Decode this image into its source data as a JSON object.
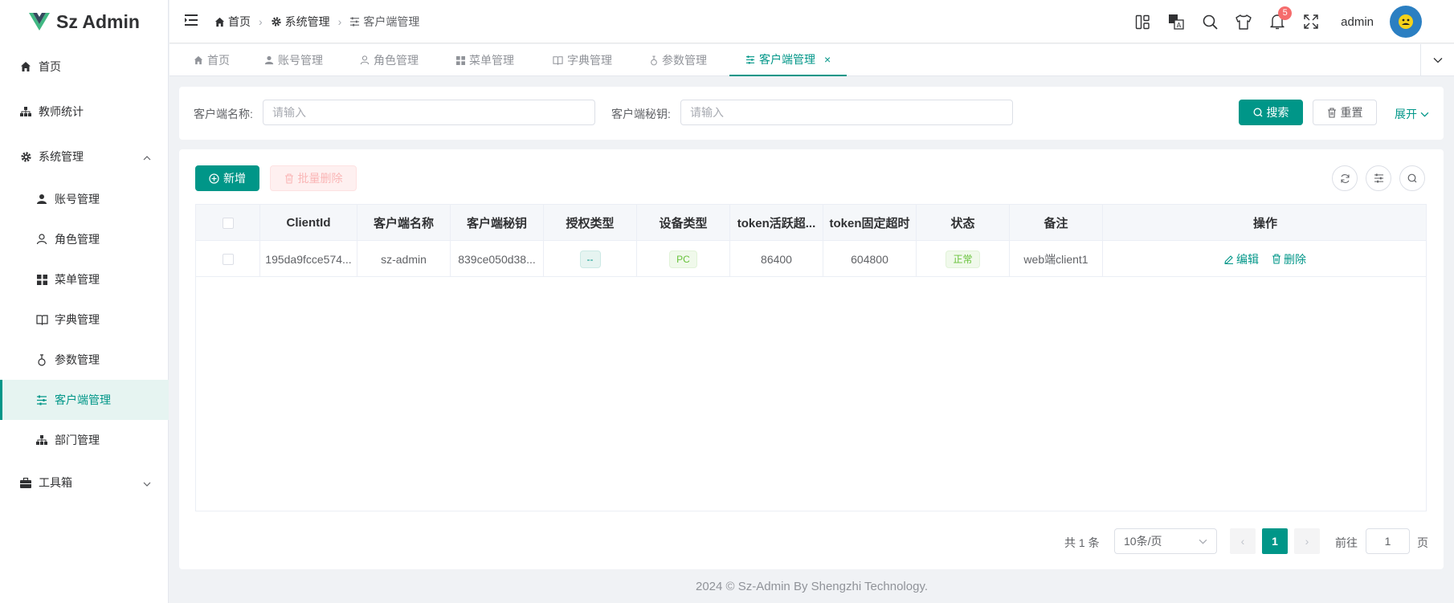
{
  "app": {
    "title": "Sz Admin"
  },
  "sidebar": {
    "items": [
      {
        "label": "首页",
        "icon": "home-icon"
      },
      {
        "label": "教师统计",
        "icon": "org-icon"
      },
      {
        "label": "系统管理",
        "icon": "gear-icon"
      },
      {
        "label": "账号管理",
        "icon": "user-icon"
      },
      {
        "label": "角色管理",
        "icon": "user-outline-icon"
      },
      {
        "label": "菜单管理",
        "icon": "grid-icon"
      },
      {
        "label": "字典管理",
        "icon": "book-icon"
      },
      {
        "label": "参数管理",
        "icon": "param-icon"
      },
      {
        "label": "客户端管理",
        "icon": "sliders-icon"
      },
      {
        "label": "部门管理",
        "icon": "org-icon"
      },
      {
        "label": "工具箱",
        "icon": "toolbox-icon"
      }
    ]
  },
  "header": {
    "breadcrumb": [
      "首页",
      "系统管理",
      "客户端管理"
    ],
    "notification_count": "5",
    "username": "admin"
  },
  "tabs": [
    {
      "label": "首页"
    },
    {
      "label": "账号管理"
    },
    {
      "label": "角色管理"
    },
    {
      "label": "菜单管理"
    },
    {
      "label": "字典管理"
    },
    {
      "label": "参数管理"
    },
    {
      "label": "客户端管理",
      "close": "×"
    }
  ],
  "search": {
    "name_label": "客户端名称:",
    "name_placeholder": "请输入",
    "secret_label": "客户端秘钥:",
    "secret_placeholder": "请输入",
    "search_btn": "搜索",
    "reset_btn": "重置",
    "expand": "展开"
  },
  "toolbar": {
    "add": "新增",
    "batch_delete": "批量删除"
  },
  "table": {
    "headers": [
      "ClientId",
      "客户端名称",
      "客户端秘钥",
      "授权类型",
      "设备类型",
      "token活跃超...",
      "token固定超时",
      "状态",
      "备注",
      "操作"
    ],
    "rows": [
      {
        "client_id": "195da9fcce574...",
        "name": "sz-admin",
        "secret": "839ce050d38...",
        "grant_type": "--",
        "device_type": "PC",
        "active_timeout": "86400",
        "fixed_timeout": "604800",
        "status": "正常",
        "remark": "web端client1",
        "edit": "编辑",
        "delete": "删除"
      }
    ]
  },
  "pagination": {
    "total": "共 1 条",
    "page_size": "10条/页",
    "current": "1",
    "goto_label": "前往",
    "goto_value": "1",
    "page_suffix": "页"
  },
  "footer": {
    "text": "2024 © Sz-Admin By Shengzhi Technology."
  },
  "colors": {
    "primary": "#009688",
    "danger": "#f56c6c",
    "success": "#67c23a"
  }
}
